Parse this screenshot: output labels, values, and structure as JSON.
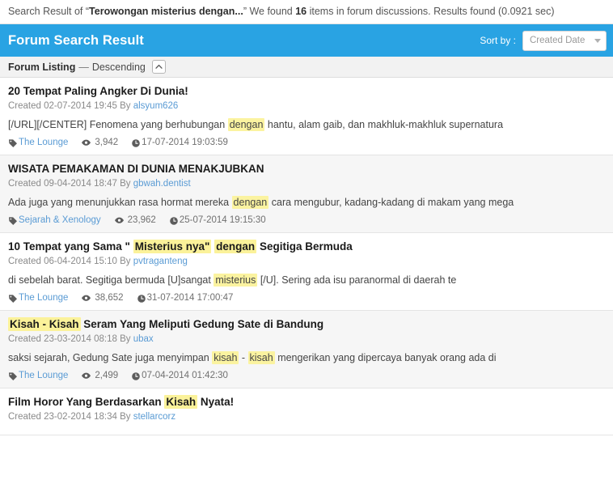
{
  "summary": {
    "prefix": "Search Result of “",
    "query": "Terowongan misterius dengan...",
    "mid": "” We found ",
    "count": "16",
    "suffix": " items in forum discussions. Results found (0.0921 sec)"
  },
  "header": {
    "title": "Forum Search Result",
    "sort_label": "Sort by :",
    "sort_value": "Created Date",
    "caret_icon": "chevron-down-icon",
    "accent_color": "#29a3e3"
  },
  "listing": {
    "label": "Forum Listing",
    "dash": "—",
    "order": "Descending",
    "direction_icon": "chevron-up-icon"
  },
  "icons": {
    "tag": "tag-icon",
    "views": "eye-icon",
    "time": "clock-icon"
  },
  "highlight_color": "#fbf3a0",
  "results": [
    {
      "title_parts": [
        {
          "text": "20 Tempat Paling Angker Di Dunia!",
          "hl": false
        }
      ],
      "created_prefix": "Created 02-07-2014 19:45 By ",
      "author": "alsyum626",
      "snippet_parts": [
        {
          "text": "[/URL][/CENTER] Fenomena yang berhubungan ",
          "hl": false
        },
        {
          "text": "dengan",
          "hl": true
        },
        {
          "text": " hantu, alam gaib, dan makhluk-makhluk supernatura",
          "hl": false
        }
      ],
      "category": "The Lounge",
      "views": "3,942",
      "time": "17-07-2014 19:03:59"
    },
    {
      "title_parts": [
        {
          "text": "WISATA PEMAKAMAN DI DUNIA MENAKJUBKAN",
          "hl": false
        }
      ],
      "created_prefix": "Created 09-04-2014 18:47 By ",
      "author": "gbwah.dentist",
      "snippet_parts": [
        {
          "text": "Ada juga yang menunjukkan rasa hormat mereka ",
          "hl": false
        },
        {
          "text": "dengan",
          "hl": true
        },
        {
          "text": " cara mengubur, kadang-kadang di makam yang mega",
          "hl": false
        }
      ],
      "category": "Sejarah & Xenology",
      "views": "23,962",
      "time": "25-07-2014 19:15:30"
    },
    {
      "title_parts": [
        {
          "text": "10 Tempat yang Sama \" ",
          "hl": false
        },
        {
          "text": "Misterius nya\"",
          "hl": true
        },
        {
          "text": " ",
          "hl": false
        },
        {
          "text": "dengan",
          "hl": true
        },
        {
          "text": " Segitiga Bermuda",
          "hl": false
        }
      ],
      "created_prefix": "Created 06-04-2014 15:10 By ",
      "author": "pvtraganteng",
      "snippet_parts": [
        {
          "text": "di sebelah barat. Segitiga bermuda [U]sangat ",
          "hl": false
        },
        {
          "text": "misterius",
          "hl": true
        },
        {
          "text": " [/U]. Sering ada isu paranormal di daerah te",
          "hl": false
        }
      ],
      "category": "The Lounge",
      "views": "38,652",
      "time": "31-07-2014 17:00:47"
    },
    {
      "title_parts": [
        {
          "text": "Kisah - Kisah",
          "hl": true
        },
        {
          "text": " Seram Yang Meliputi Gedung Sate di Bandung",
          "hl": false
        }
      ],
      "created_prefix": "Created 23-03-2014 08:18 By ",
      "author": "ubax",
      "snippet_parts": [
        {
          "text": "saksi sejarah, Gedung Sate juga menyimpan ",
          "hl": false
        },
        {
          "text": "kisah",
          "hl": true
        },
        {
          "text": " - ",
          "hl": false
        },
        {
          "text": "kisah",
          "hl": true
        },
        {
          "text": " mengerikan yang dipercaya banyak orang ada di",
          "hl": false
        }
      ],
      "category": "The Lounge",
      "views": "2,499",
      "time": "07-04-2014 01:42:30"
    },
    {
      "title_parts": [
        {
          "text": "Film Horor Yang Berdasarkan ",
          "hl": false
        },
        {
          "text": "Kisah",
          "hl": true
        },
        {
          "text": " Nyata!",
          "hl": false
        }
      ],
      "created_prefix": "Created 23-02-2014 18:34 By ",
      "author": "stellarcorz",
      "snippet_parts": [],
      "category": "",
      "views": "",
      "time": ""
    }
  ]
}
